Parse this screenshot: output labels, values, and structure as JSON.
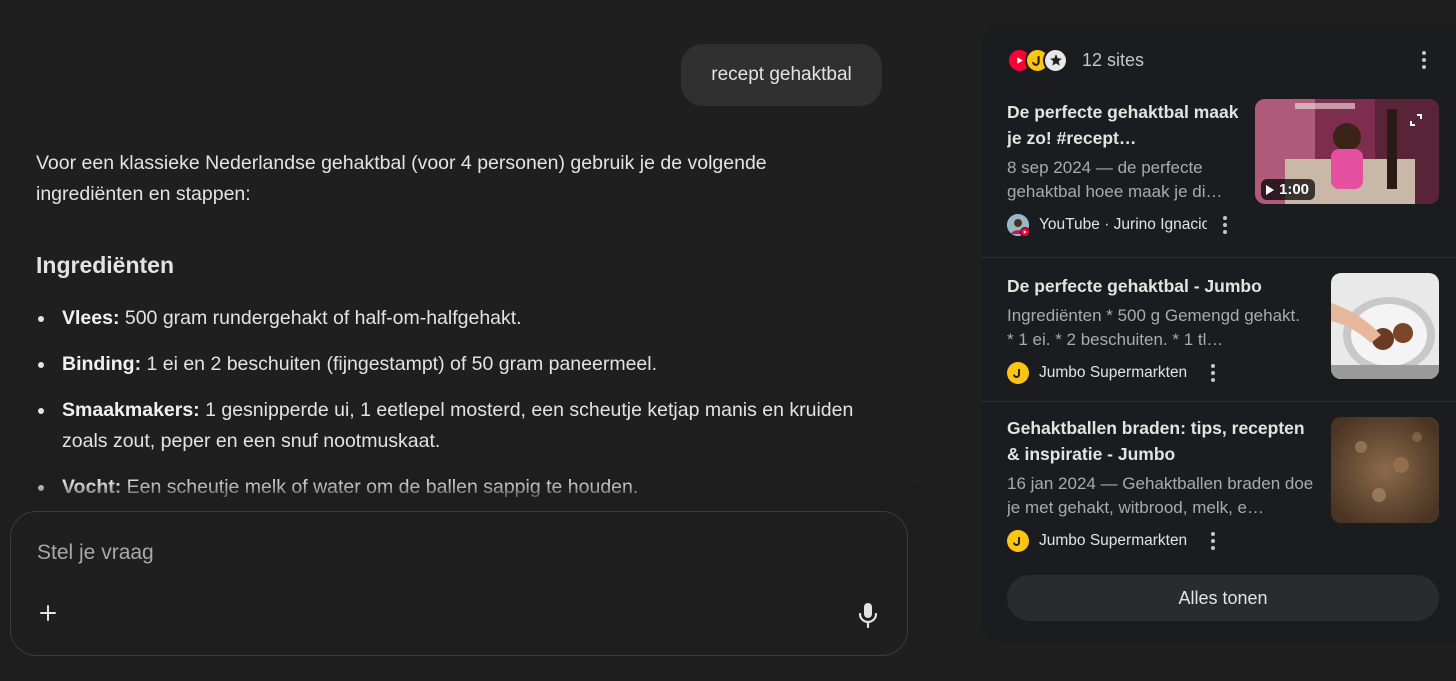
{
  "chat": {
    "user_message": "recept gehaktbal",
    "answer": {
      "intro": "Voor een klassieke Nederlandse gehaktbal (voor 4 personen) gebruik je de volgende ingrediënten en stappen:",
      "heading": "Ingrediënten",
      "items": [
        {
          "label": "Vlees:",
          "text": " 500 gram rundergehakt of half-om-halfgehakt."
        },
        {
          "label": "Binding:",
          "text": " 1 ei en 2 beschuiten (fijngestampt) of 50 gram paneermeel."
        },
        {
          "label": "Smaakmakers:",
          "text": " 1 gesnipperde ui, 1 eetlepel mosterd, een scheutje ketjap manis en kruiden zoals zout, peper en een snuf nootmuskaat."
        },
        {
          "label": "Vocht:",
          "text": " Een scheutje melk of water om de ballen sappig te houden."
        }
      ]
    },
    "composer": {
      "placeholder": "Stel je vraag",
      "plus_icon": "plus-icon",
      "mic_icon": "microphone-icon"
    }
  },
  "sources_panel": {
    "count_label": "12 sites",
    "favicons": [
      "youtube-icon",
      "jumbo-icon",
      "star-icon"
    ],
    "sources": [
      {
        "title": "De perfecte gehaktbal maak je zo! #recept…",
        "snippet": "8 sep 2024 — de perfecte gehaktbal hoee maak je di…",
        "site": "YouTube · Jurino Ignacio",
        "thumbnail": "video-thumbnail",
        "duration": "1:00"
      },
      {
        "title": "De perfecte gehaktbal - Jumbo",
        "snippet": "Ingrediënten * 500 g Gemengd gehakt. * 1 ei. * 2 beschuiten. * 1 tl…",
        "site": "Jumbo Supermarkten",
        "thumbnail": "meatball-pan-photo"
      },
      {
        "title": "Gehaktballen braden: tips, recepten & inspiratie - Jumbo",
        "snippet": "16 jan 2024 — Gehaktballen braden doe je met gehakt, witbrood, melk, e…",
        "site": "Jumbo Supermarkten",
        "thumbnail": "minced-meat-photo"
      }
    ],
    "show_all_label": "Alles tonen"
  },
  "colors": {
    "background": "#1f1f1f",
    "panel": "#1b1c1f",
    "youtube_red": "#ff0033",
    "jumbo_yellow": "#fdc513"
  }
}
